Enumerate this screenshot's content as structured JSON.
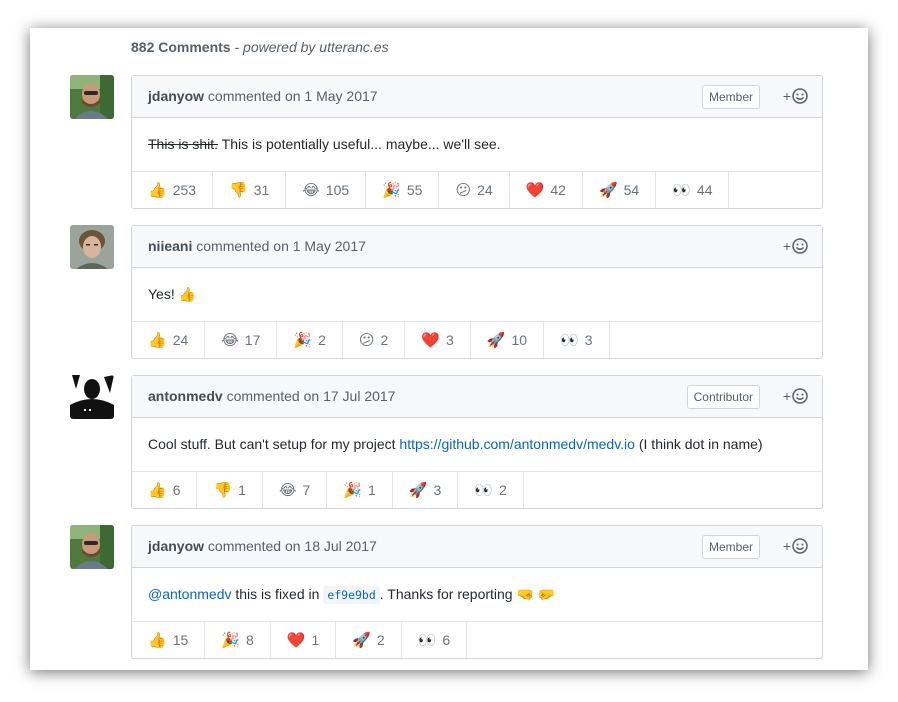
{
  "header": {
    "count": "882 Comments",
    "powered": " - powered by utteranc.es"
  },
  "comments": [
    {
      "login": "jdanyow",
      "meta": " commented on 1 May 2017",
      "badge": "Member",
      "body": {
        "strike": "This is shit.",
        "text": " This is potentially useful... maybe... we'll see."
      },
      "reactions": [
        {
          "emoji": "👍",
          "count": "253"
        },
        {
          "emoji": "👎",
          "count": "31"
        },
        {
          "emoji": "😂",
          "count": "105"
        },
        {
          "emoji": "🎉",
          "count": "55"
        },
        {
          "emoji": "😕",
          "count": "24"
        },
        {
          "emoji": "❤️",
          "count": "42"
        },
        {
          "emoji": "🚀",
          "count": "54"
        },
        {
          "emoji": "👀",
          "count": "44"
        }
      ]
    },
    {
      "login": "niieani",
      "meta": " commented on 1 May 2017",
      "badge": "",
      "body": {
        "text": "Yes! 👍"
      },
      "reactions": [
        {
          "emoji": "👍",
          "count": "24"
        },
        {
          "emoji": "😂",
          "count": "17"
        },
        {
          "emoji": "🎉",
          "count": "2"
        },
        {
          "emoji": "😕",
          "count": "2"
        },
        {
          "emoji": "❤️",
          "count": "3"
        },
        {
          "emoji": "🚀",
          "count": "10"
        },
        {
          "emoji": "👀",
          "count": "3"
        }
      ]
    },
    {
      "login": "antonmedv",
      "meta": " commented on 17 Jul 2017",
      "badge": "Contributor",
      "body": {
        "text": "Cool stuff. But can't setup for my project ",
        "link": "https://github.com/antonmedv/medv.io",
        "after": " (I think dot in name)"
      },
      "reactions": [
        {
          "emoji": "👍",
          "count": "6"
        },
        {
          "emoji": "👎",
          "count": "1"
        },
        {
          "emoji": "😂",
          "count": "7"
        },
        {
          "emoji": "🎉",
          "count": "1"
        },
        {
          "emoji": "🚀",
          "count": "3"
        },
        {
          "emoji": "👀",
          "count": "2"
        }
      ]
    },
    {
      "login": "jdanyow",
      "meta": " commented on 18 Jul 2017",
      "badge": "Member",
      "body": {
        "mention": "@antonmedv",
        "text": " this is fixed in ",
        "code": "ef9e9bd",
        "after": ". Thanks for reporting 🤜 🤛"
      },
      "reactions": [
        {
          "emoji": "👍",
          "count": "15"
        },
        {
          "emoji": "🎉",
          "count": "8"
        },
        {
          "emoji": "❤️",
          "count": "1"
        },
        {
          "emoji": "🚀",
          "count": "2"
        },
        {
          "emoji": "👀",
          "count": "6"
        }
      ]
    }
  ],
  "add_reaction": {
    "plus": "+",
    "icon": "smiley-icon"
  }
}
